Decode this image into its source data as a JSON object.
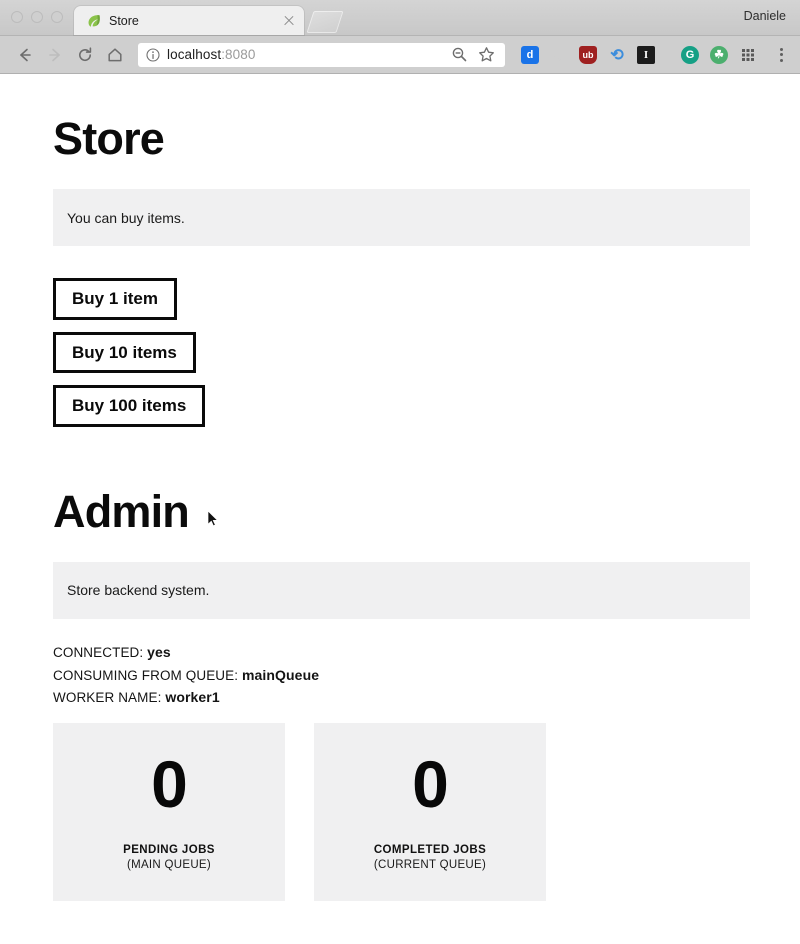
{
  "browser": {
    "profile_name": "Daniele",
    "tab": {
      "title": "Store",
      "favicon": "leaf-icon",
      "close": "close-icon"
    },
    "nav": {
      "back": "back-arrow-icon",
      "forward": "forward-arrow-icon",
      "reload": "reload-icon",
      "home": "home-icon"
    },
    "omnibox": {
      "info_icon": "info-circle-icon",
      "url_host": "localhost",
      "url_port": ":8080",
      "zoom_icon": "zoom-out-icon",
      "bookmark_icon": "star-icon"
    },
    "extensions": [
      {
        "name": "dashlane-extension-icon",
        "glyph": "d",
        "fg": "#ffffff",
        "bg": "#1a73e8"
      },
      {
        "name": "diamond-extension-icon",
        "glyph": "◇",
        "fg": "#c9c9c9",
        "bg": "transparent"
      },
      {
        "name": "ublock-origin-extension-icon",
        "glyph": "Ⓤ",
        "fg": "#ffffff",
        "bg": "#9f2020"
      },
      {
        "name": "sync-extension-icon",
        "glyph": "↻",
        "fg": "#ffffff",
        "bg": "#3c8ddc"
      },
      {
        "name": "italic-extension-icon",
        "glyph": "I",
        "fg": "#ffffff",
        "bg": "#1c1c1c"
      },
      {
        "name": "grammarly-extension-icon",
        "glyph": "G",
        "fg": "#ffffff",
        "bg": "#16a085"
      },
      {
        "name": "privacy-extension-icon",
        "glyph": "☘",
        "fg": "#ffffff",
        "bg": "#4caf6e"
      },
      {
        "name": "apps-grid-icon",
        "glyph": "∷",
        "fg": "#5a5a5a",
        "bg": "transparent"
      }
    ],
    "menu_icon": "three-dot-menu-icon"
  },
  "store": {
    "heading": "Store",
    "alert_text": "You can buy items.",
    "buttons": [
      {
        "label": "Buy 1 item"
      },
      {
        "label": "Buy 10 items"
      },
      {
        "label": "Buy 100 items"
      }
    ]
  },
  "admin": {
    "heading": "Admin",
    "alert_text": "Store backend system.",
    "status": [
      {
        "label": "CONNECTED:",
        "value": "yes"
      },
      {
        "label": "CONSUMING FROM QUEUE:",
        "value": "mainQueue"
      },
      {
        "label": "WORKER NAME:",
        "value": "worker1"
      }
    ],
    "cards": [
      {
        "value": "0",
        "label": "PENDING JOBS",
        "sublabel": "(MAIN QUEUE)"
      },
      {
        "value": "0",
        "label": "COMPLETED JOBS",
        "sublabel": "(CURRENT QUEUE)"
      }
    ]
  },
  "colors": {
    "alert_bg": "#f0f0f1",
    "button_border": "#0a0a0a",
    "text": "#0b0b0b",
    "chrome_bg": "#cfcfcf"
  }
}
